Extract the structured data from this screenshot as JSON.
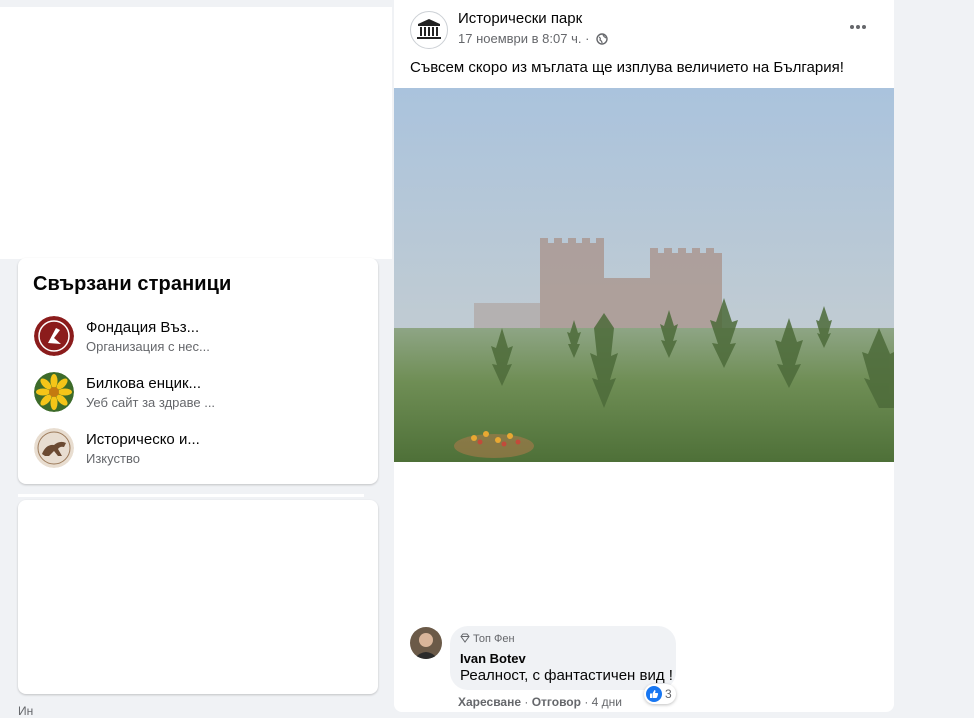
{
  "related": {
    "title": "Свързани страници",
    "items": [
      {
        "name": "Фондация Въз...",
        "category": "Организация с нес..."
      },
      {
        "name": "Билкова енцик...",
        "category": "Уеб сайт за здраве ..."
      },
      {
        "name": "Историческо и...",
        "category": "Изкуство"
      }
    ]
  },
  "bottom_left_text": "Ин",
  "post": {
    "page_name": "Исторически парк",
    "date": "17 ноември в 8:07 ч.",
    "separator": "·",
    "text": "Съвсем скоро из мъглата ще изплува величието на България!"
  },
  "comment": {
    "badge": "Топ Фен",
    "author": "Ivan Botev",
    "text": "Реалност, с фантастичен вид !",
    "reaction_count": "3",
    "like_label": "Харесване",
    "dot": "·",
    "reply_label": "Отговор",
    "time": "4 дни"
  },
  "colors": {
    "accent": "#1877f2",
    "secondary_text": "#65676b",
    "background": "#f0f2f5"
  }
}
